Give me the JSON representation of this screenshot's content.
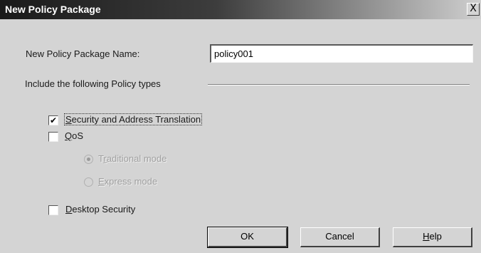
{
  "window": {
    "title": "New Policy Package",
    "close_symbol": "X"
  },
  "form": {
    "name_label": "New Policy Package Name:",
    "name_value": "policy001",
    "include_label": "Include the following Policy types"
  },
  "options": {
    "security": {
      "label_pre": "",
      "label_mnemonic": "S",
      "label_post": "ecurity and Address Translation",
      "checked": true,
      "check_symbol": "✔"
    },
    "qos": {
      "label_pre": "",
      "label_mnemonic": "Q",
      "label_post": "oS",
      "checked": false
    },
    "traditional": {
      "label_pre": "T",
      "label_mnemonic": "r",
      "label_post": "aditional mode",
      "selected": true
    },
    "express": {
      "label_pre": "",
      "label_mnemonic": "E",
      "label_post": "xpress mode",
      "selected": false
    },
    "desktop": {
      "label_pre": "",
      "label_mnemonic": "D",
      "label_post": "esktop Security",
      "checked": false
    }
  },
  "buttons": {
    "ok": "OK",
    "cancel": "Cancel",
    "help_mnemonic": "H",
    "help_post": "elp"
  }
}
